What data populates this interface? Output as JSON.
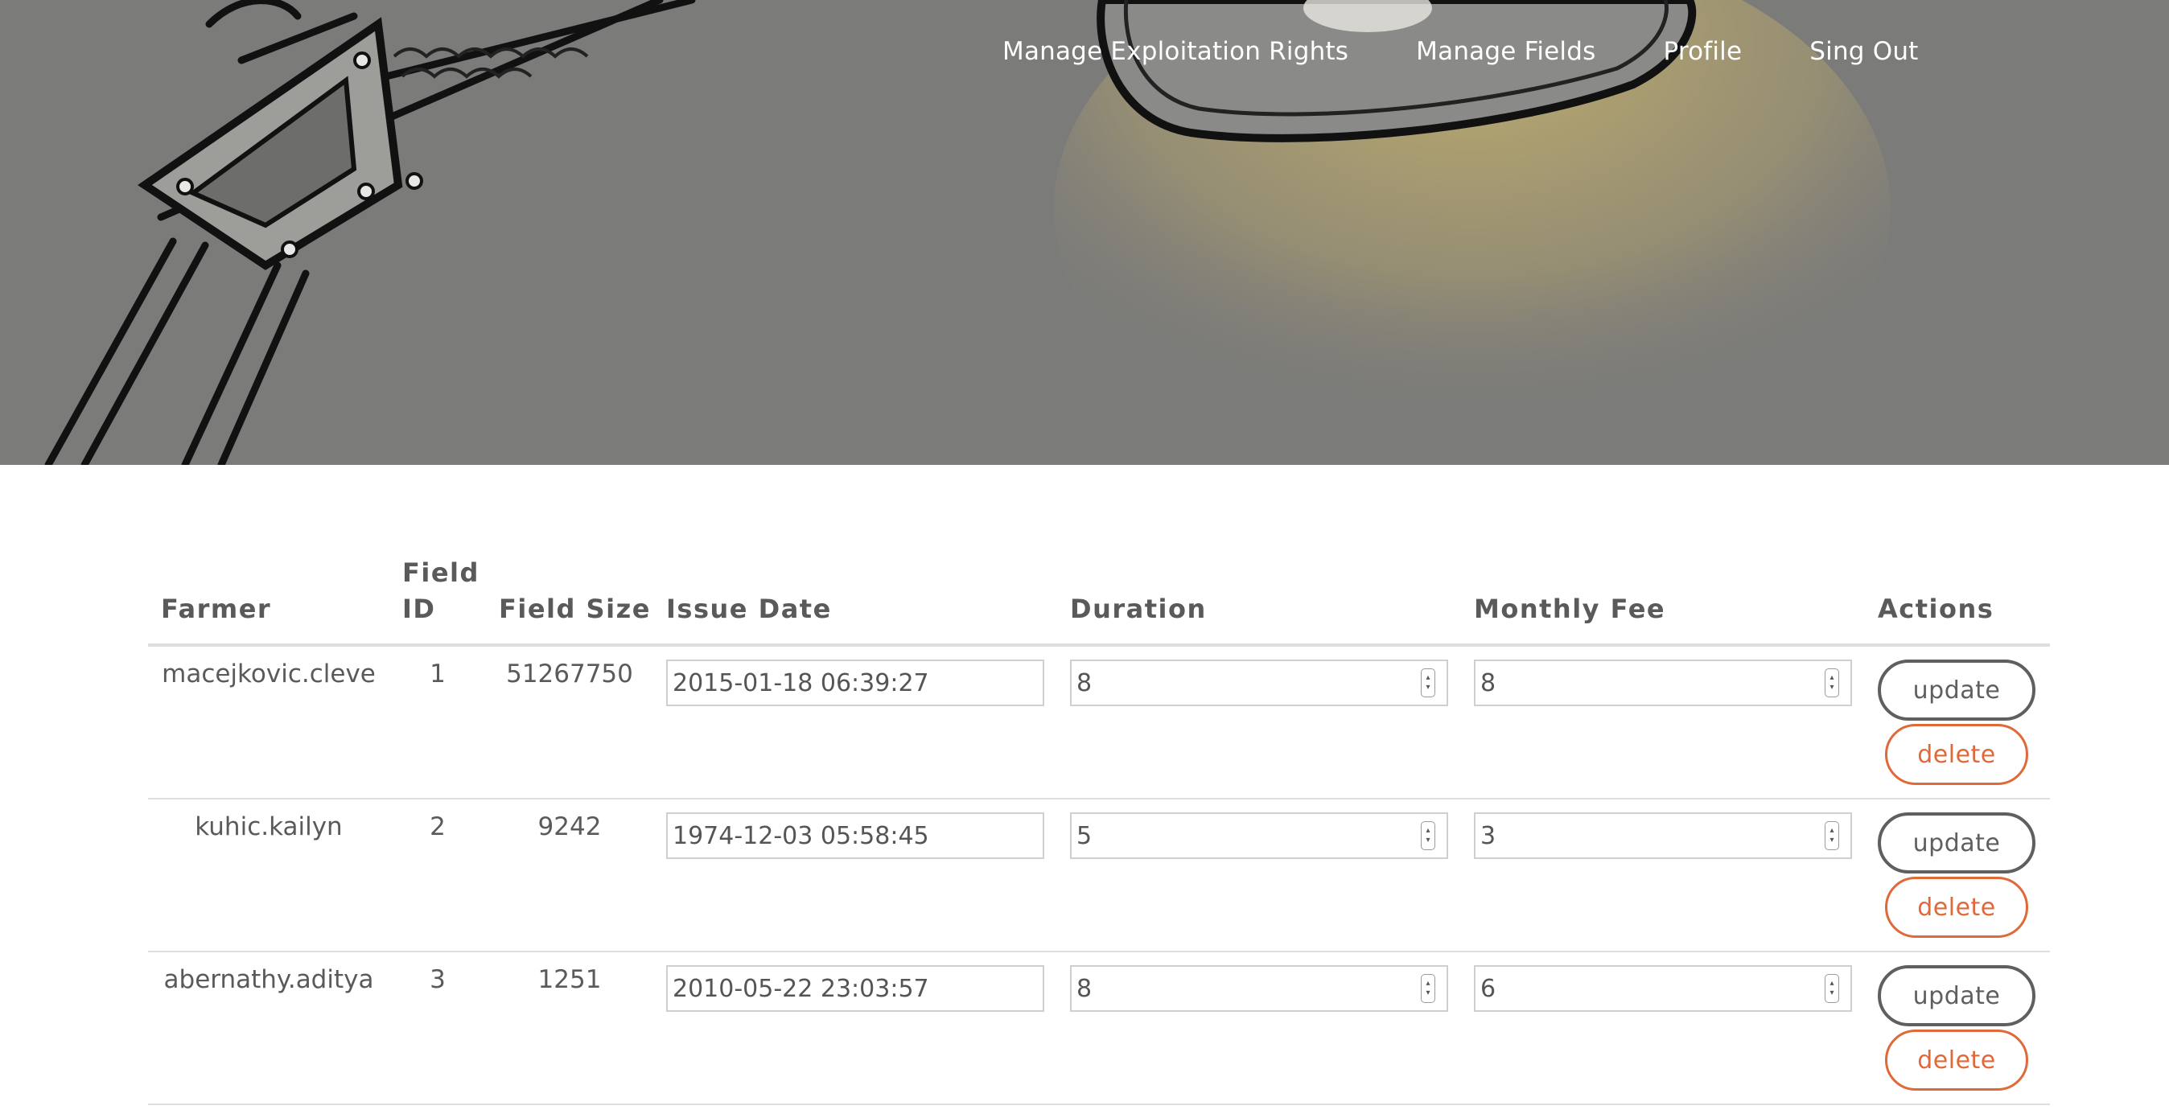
{
  "nav": {
    "items": [
      {
        "label": "Manage Exploitation Rights"
      },
      {
        "label": "Manage Fields"
      },
      {
        "label": "Profile"
      },
      {
        "label": "Sing Out"
      }
    ]
  },
  "table": {
    "headers": {
      "farmer": "Farmer",
      "field_id": "Field ID",
      "field_size": "Field Size",
      "issue_date": "Issue Date",
      "duration": "Duration",
      "monthly_fee": "Monthly Fee",
      "actions": "Actions"
    },
    "rows": [
      {
        "farmer": "macejkovic.cleve",
        "field_id": "1",
        "field_size": "51267750",
        "issue_date": "2015-01-18 06:39:27",
        "duration": "8",
        "monthly_fee": "8",
        "update_label": "update",
        "delete_label": "delete"
      },
      {
        "farmer": "kuhic.kailyn",
        "field_id": "2",
        "field_size": "9242",
        "issue_date": "1974-12-03 05:58:45",
        "duration": "5",
        "monthly_fee": "3",
        "update_label": "update",
        "delete_label": "delete"
      },
      {
        "farmer": "abernathy.aditya",
        "field_id": "3",
        "field_size": "1251",
        "issue_date": "2010-05-22 23:03:57",
        "duration": "8",
        "monthly_fee": "6",
        "update_label": "update",
        "delete_label": "delete"
      }
    ]
  },
  "colors": {
    "hero_background": "#7b7b79",
    "update_button": "#5f5f5f",
    "delete_button": "#e0693a"
  },
  "icons": {
    "spinner": "up-down-spinner-icon"
  }
}
